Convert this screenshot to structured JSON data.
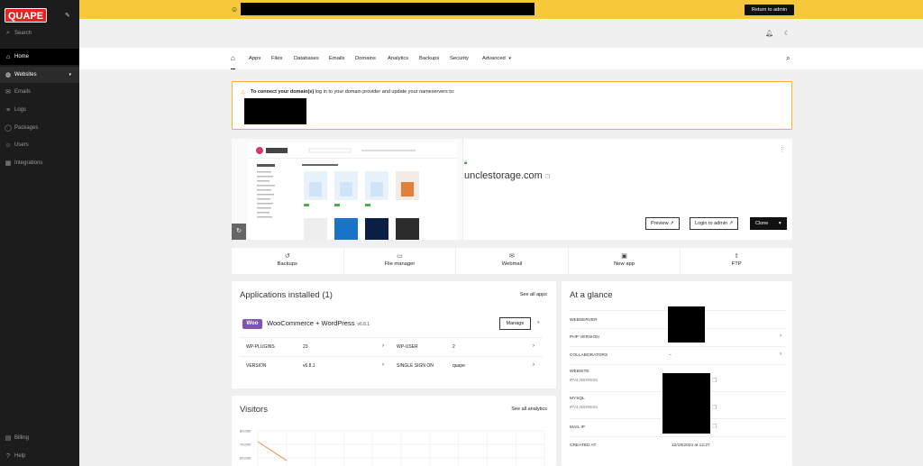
{
  "sidebar": {
    "logo": "QUAPE",
    "items": [
      {
        "label": "Search",
        "icon": "search-icon"
      },
      {
        "label": "Home",
        "icon": "home-icon"
      },
      {
        "label": "Websites",
        "icon": "globe-icon"
      },
      {
        "label": "Emails",
        "icon": "mail-icon"
      },
      {
        "label": "Logs",
        "icon": "list-icon"
      },
      {
        "label": "Packages",
        "icon": "package-icon"
      },
      {
        "label": "Users",
        "icon": "users-icon"
      },
      {
        "label": "Integrations",
        "icon": "grid-icon"
      },
      {
        "label": "Billing",
        "icon": "billing-icon"
      },
      {
        "label": "Help",
        "icon": "help-icon"
      }
    ]
  },
  "banner": {
    "return_label": "Return to admin",
    "color": "#f7c83a"
  },
  "tabs": [
    "Apps",
    "Files",
    "Databases",
    "Emails",
    "Domains",
    "Analytics",
    "Backups",
    "Security",
    "Advanced"
  ],
  "notice": {
    "bold": "To connect your domain(s)",
    "text": " log in to your domain provider and update your nameservers to:"
  },
  "site": {
    "domain": "unclestorage.com",
    "preview_label": "Preview",
    "login_label": "Login to admin",
    "clone_label": "Clone"
  },
  "actions": [
    {
      "label": "Backups",
      "icon": "backup-icon"
    },
    {
      "label": "File manager",
      "icon": "folder-icon"
    },
    {
      "label": "Webmail",
      "icon": "mail-icon"
    },
    {
      "label": "New app",
      "icon": "new-app-icon"
    },
    {
      "label": "FTP",
      "icon": "upload-icon"
    }
  ],
  "apps": {
    "title": "Applications installed (1)",
    "see_all": "See all apps",
    "badge": "Woo",
    "app_name": "WooCommerce + WordPress",
    "app_version": "v6.8.1",
    "manage_label": "Manage",
    "rows": [
      {
        "k1": "WP-PLUGINS",
        "v1": "23",
        "k2": "WP-USER",
        "v2": "2"
      },
      {
        "k1": "VERSION",
        "v1": "v6.8.1",
        "k2": "SINGLE SIGN ON",
        "v2": "quape"
      }
    ]
  },
  "glance": {
    "title": "At a glance",
    "webserver": "WEBSERVER",
    "php": "PHP VERSION",
    "collaborators": "COLLABORATORS",
    "collaborators_value": "–",
    "website": "WEBSITE",
    "website_sub": "IPV4 ADDRESS",
    "mysql": "MYSQL",
    "mysql_sub": "IPV4 ADDRESS",
    "mail": "MAIL IP",
    "created": "CREATED AT",
    "created_value": "12/19/2024 at 12:27"
  },
  "visitors": {
    "title": "Visitors",
    "see_all": "See all analytics"
  },
  "chart_data": {
    "type": "line",
    "ytick_labels": [
      "80,000",
      "70,000",
      "60,000"
    ],
    "y": [
      72000,
      58000
    ],
    "x": [
      0,
      1
    ]
  }
}
